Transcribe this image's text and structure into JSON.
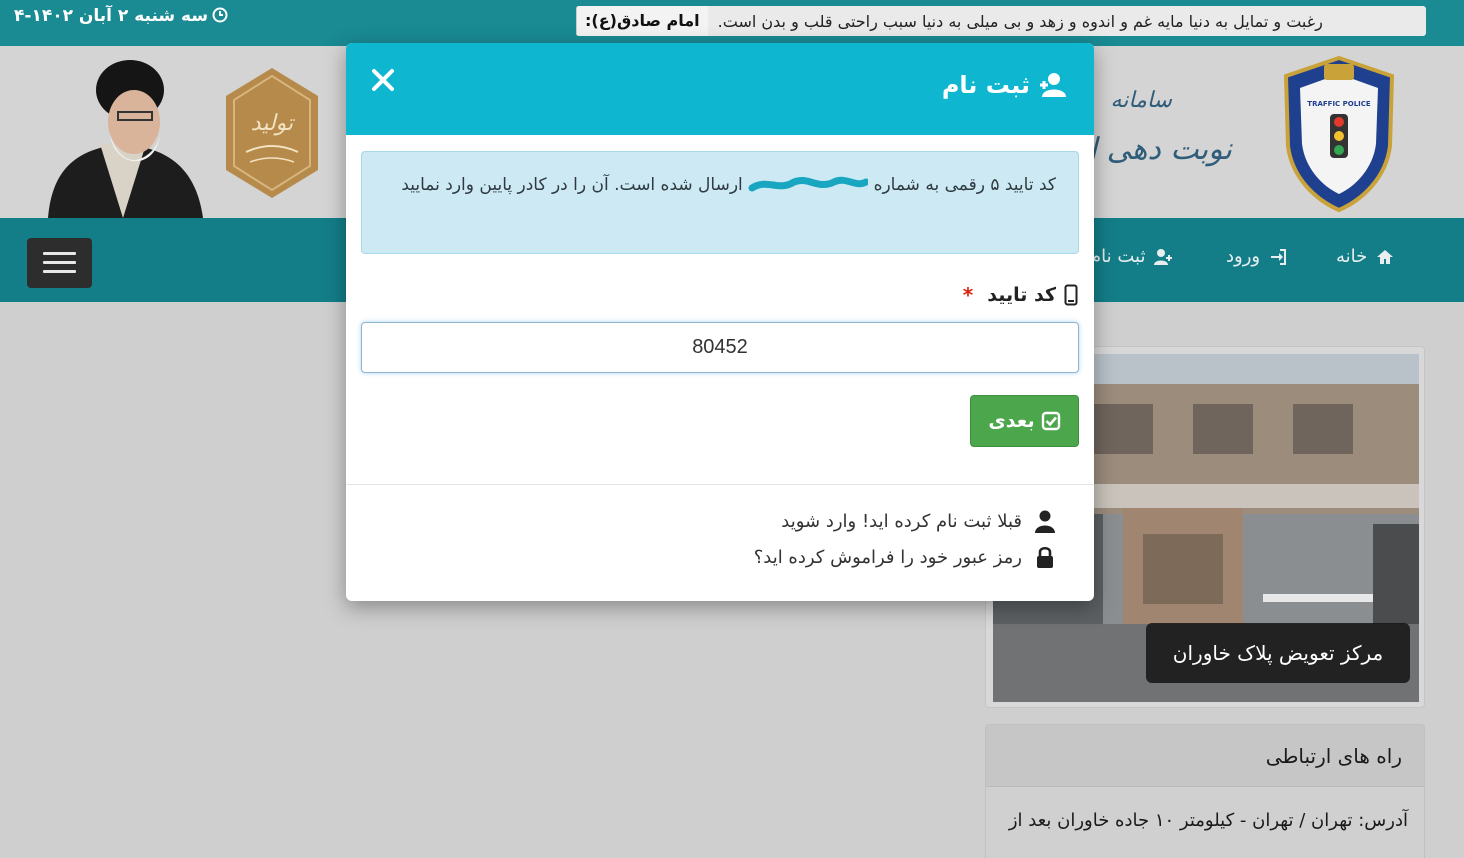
{
  "topbar": {
    "quote_source": "امام صادق(ع):",
    "quote_text": "رغبت و تمایل به دنیا مایه غم و اندوه و زهد و بی میلی به دنیا سبب راحتی قلب و بدن است.",
    "date": "سه شنبه ۲ آبان ۱۴۰۲-۴"
  },
  "header": {
    "title_line1": "سامانه",
    "title_line2": "نوبت دهی اینترنتی",
    "hex_logo_text": "تولید",
    "police_badge_text": "TRAFFIC POLICE"
  },
  "navbar": {
    "items": [
      {
        "label": "خانه",
        "icon": "home-icon"
      },
      {
        "label": "ورود",
        "icon": "sign-in-icon"
      },
      {
        "label": "ثبت نام",
        "icon": "user-plus-icon"
      }
    ],
    "menu_icon": "hamburger-menu-icon"
  },
  "main": {
    "photo_caption": "مرکز تعویض پلاک خاوران",
    "contact_title": "راه های ارتباطی",
    "contact_address": "آدرس: تهران / تهران - کیلومتر ۱۰ جاده خاوران بعد از"
  },
  "modal": {
    "title": "ثبت نام",
    "alert_text_before": "کد تایید ۵ رقمی به شماره",
    "alert_text_after": "ارسال شده است. آن را در کادر پایین وارد نمایید",
    "field_label": "کد تایید",
    "required_mark": "*",
    "code_value": "80452",
    "next_button": "بعدی",
    "link_login": "قبلا ثبت نام کرده اید! وارد شوید",
    "link_forgot": "رمز عبور خود را فراموش کرده اید؟"
  },
  "colors": {
    "topbar": "#1a8a93",
    "navbar": "#137e88",
    "modal_header": "#0fb6cf",
    "alert_bg": "#cde9f4",
    "button_green": "#4ca64c",
    "required": "#d9230f"
  }
}
